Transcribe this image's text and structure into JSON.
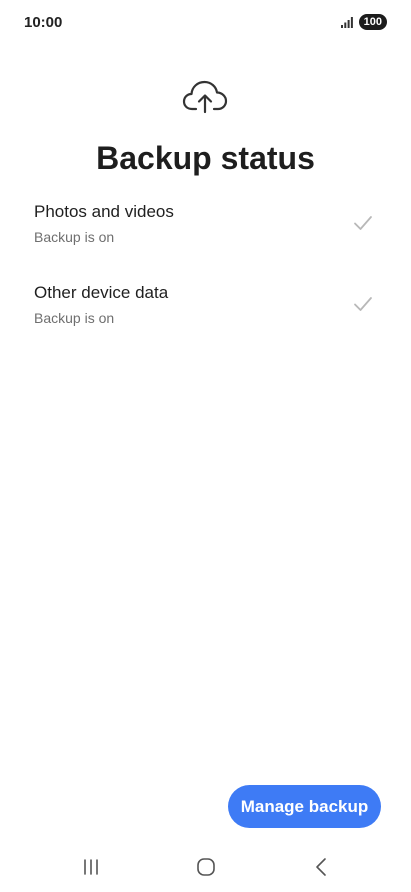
{
  "status_bar": {
    "time": "10:00",
    "signal_icon": "signal-bars-icon",
    "battery": "100"
  },
  "header": {
    "icon": "cloud-upload-icon",
    "title": "Backup status"
  },
  "items": [
    {
      "title": "Photos and videos",
      "subtitle": "Backup is on",
      "icon": "check-icon"
    },
    {
      "title": "Other device data",
      "subtitle": "Backup is on",
      "icon": "check-icon"
    }
  ],
  "actions": {
    "manage_label": "Manage backup"
  },
  "nav": {
    "recents_icon": "recents-icon",
    "home_icon": "home-icon",
    "back_icon": "back-icon"
  },
  "colors": {
    "accent": "#3e7bf5",
    "text_primary": "#1f1f1f",
    "text_secondary": "#6f6f6f",
    "check": "#b8b8b8"
  }
}
